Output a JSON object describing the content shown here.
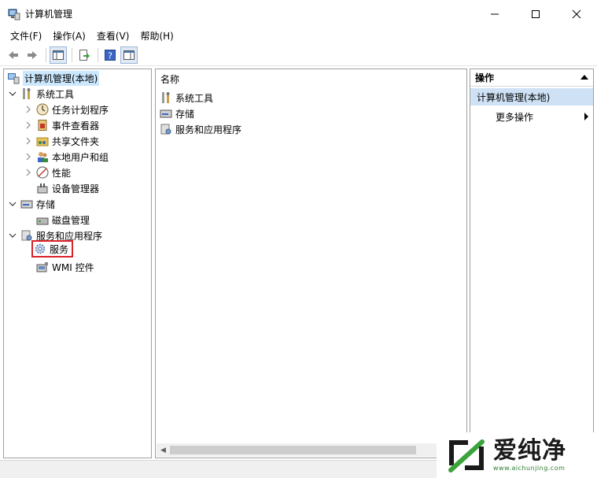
{
  "window": {
    "title": "计算机管理",
    "controls": {
      "minimize": "minimize-icon",
      "maximize": "maximize-icon",
      "close": "close-icon"
    }
  },
  "menu": {
    "file": "文件(F)",
    "action": "操作(A)",
    "view": "查看(V)",
    "help": "帮助(H)"
  },
  "toolbar": {
    "icons": [
      "back-arrow-icon",
      "forward-arrow-icon",
      "show-hide-console-tree-icon",
      "export-list-icon",
      "help-icon",
      "show-hide-action-pane-icon"
    ]
  },
  "tree": {
    "root": "计算机管理(本地)",
    "system_tools": "系统工具",
    "task_scheduler": "任务计划程序",
    "event_viewer": "事件查看器",
    "shared_folders": "共享文件夹",
    "local_users": "本地用户和组",
    "performance": "性能",
    "device_manager": "设备管理器",
    "storage": "存储",
    "disk_management": "磁盘管理",
    "services_apps": "服务和应用程序",
    "services": "服务",
    "wmi": "WMI 控件"
  },
  "middle": {
    "header": "名称",
    "items": [
      "系统工具",
      "存储",
      "服务和应用程序"
    ]
  },
  "actions": {
    "header": "操作",
    "section": "计算机管理(本地)",
    "more": "更多操作"
  },
  "watermark": {
    "title": "爱纯净",
    "url": "www.aichunjing.com"
  },
  "colors": {
    "selection_bg": "#cce8ff",
    "actions_section_bg": "#cfe1f5",
    "highlight_border": "#d9232a",
    "watermark_green": "#2e7d32"
  }
}
